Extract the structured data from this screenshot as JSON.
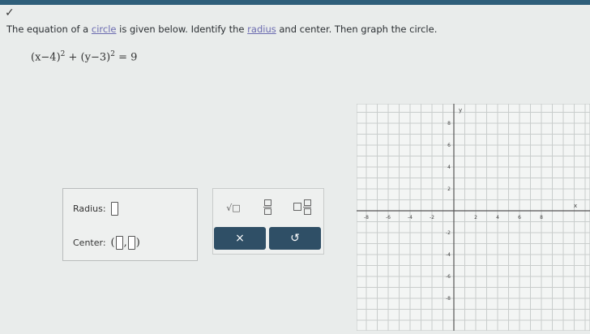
{
  "header": {
    "check_icon": "checkmark-icon"
  },
  "question": {
    "text_before_circle": "The equation of a ",
    "term_circle": "circle",
    "text_middle": " is given below. Identify the ",
    "term_radius": "radius",
    "text_after": " and center. Then graph the circle."
  },
  "equation": {
    "part1": "(x−4)",
    "exp1": "2",
    "plus": " + ",
    "part2": "(y−3)",
    "exp2": "2",
    "rhs": " = 9"
  },
  "answer": {
    "radius_label": "Radius:",
    "center_label": "Center:",
    "open_paren": "(",
    "comma": ",",
    "close_paren": ")"
  },
  "toolbar": {
    "sqrt_label": "√□",
    "clear_label": "×",
    "undo_label": "↺"
  },
  "graph": {
    "x_ticks": [
      "-8",
      "-6",
      "-4",
      "-2",
      "2",
      "4",
      "6",
      "8"
    ],
    "y_ticks": [
      "8",
      "6",
      "4",
      "2",
      "-2",
      "-4",
      "-6",
      "-8"
    ],
    "x_axis_label": "x",
    "y_axis_label": "y"
  }
}
